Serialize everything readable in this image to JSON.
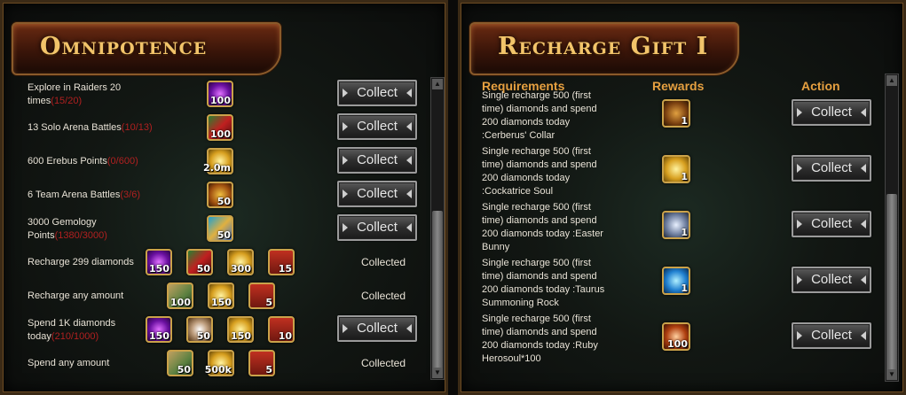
{
  "omnipotence": {
    "title": "Omnipotence",
    "collect_label": "Collect",
    "collected_label": "Collected",
    "rows": [
      {
        "text": "Explore in Raiders 20 times",
        "progress": "(15/20)",
        "items": [
          {
            "icon": "purple-orb-icon",
            "count": "100"
          }
        ],
        "state": "collect"
      },
      {
        "text": "13 Solo Arena Battles",
        "progress": "(10/13)",
        "items": [
          {
            "icon": "red-crystal-icon",
            "count": "100"
          }
        ],
        "state": "collect"
      },
      {
        "text": "600 Erebus Points",
        "progress": "(0/600)",
        "items": [
          {
            "icon": "gold-coin-icon",
            "count": "2.0m"
          }
        ],
        "state": "collect"
      },
      {
        "text": "6 Team Arena Battles",
        "progress": "(3/6)",
        "items": [
          {
            "icon": "shield-icon",
            "count": "50"
          }
        ],
        "state": "collect"
      },
      {
        "text": "3000 Gemology Points",
        "progress": "(1380/3000)",
        "items": [
          {
            "icon": "gem-icon",
            "count": "50"
          }
        ],
        "state": "collect"
      },
      {
        "text": "Recharge 299 diamonds",
        "progress": "",
        "items": [
          {
            "icon": "purple-orb-icon",
            "count": "150"
          },
          {
            "icon": "red-crystal-icon",
            "count": "50"
          },
          {
            "icon": "gold-coin-icon",
            "count": "300"
          },
          {
            "icon": "prize-box-icon",
            "count": "15"
          }
        ],
        "state": "collected"
      },
      {
        "text": "Recharge any amount",
        "progress": "",
        "items": [
          {
            "icon": "scroll-icon",
            "count": "100"
          },
          {
            "icon": "gold-coin-icon",
            "count": "150"
          },
          {
            "icon": "prize-box-icon",
            "count": "5"
          }
        ],
        "state": "collected"
      },
      {
        "text": "Spend 1K diamonds today",
        "progress": "(210/1000)",
        "items": [
          {
            "icon": "purple-orb-icon",
            "count": "150"
          },
          {
            "icon": "pearl-icon",
            "count": "50"
          },
          {
            "icon": "gold-coin-icon",
            "count": "150"
          },
          {
            "icon": "prize-box-icon",
            "count": "10"
          }
        ],
        "state": "collect"
      },
      {
        "text": "Spend any amount",
        "progress": "",
        "items": [
          {
            "icon": "scroll-icon",
            "count": "50"
          },
          {
            "icon": "gold-coin-icon",
            "count": "500k"
          },
          {
            "icon": "prize-box-icon",
            "count": "5"
          }
        ],
        "state": "collected"
      }
    ]
  },
  "recharge_gift": {
    "title": "Recharge Gift Ⅰ",
    "columns": {
      "requirements": "Requirements",
      "rewards": "Rewards",
      "action": "Action"
    },
    "collect_label": "Collect",
    "rows": [
      {
        "text": "Single recharge 500 (first time) diamonds and spend 200 diamonds today :Cerberus' Collar",
        "reward": {
          "icon": "cerberus-collar-icon",
          "count": "1"
        }
      },
      {
        "text": "Single recharge 500 (first time) diamonds and spend 200 diamonds today :Cockatrice Soul",
        "reward": {
          "icon": "cockatrice-soul-icon",
          "count": "1"
        }
      },
      {
        "text": "Single recharge 500 (first time) diamonds and spend 200 diamonds today :Easter Bunny",
        "reward": {
          "icon": "easter-bunny-icon",
          "count": "1"
        }
      },
      {
        "text": "Single recharge 500 (first time) diamonds and spend 200 diamonds today :Taurus Summoning Rock",
        "reward": {
          "icon": "taurus-rock-icon",
          "count": "1"
        }
      },
      {
        "text": "Single recharge 500 (first time) diamonds and spend 200 diamonds today :Ruby Herosoul*100",
        "reward": {
          "icon": "ruby-herosoul-icon",
          "count": "100"
        }
      }
    ]
  }
}
